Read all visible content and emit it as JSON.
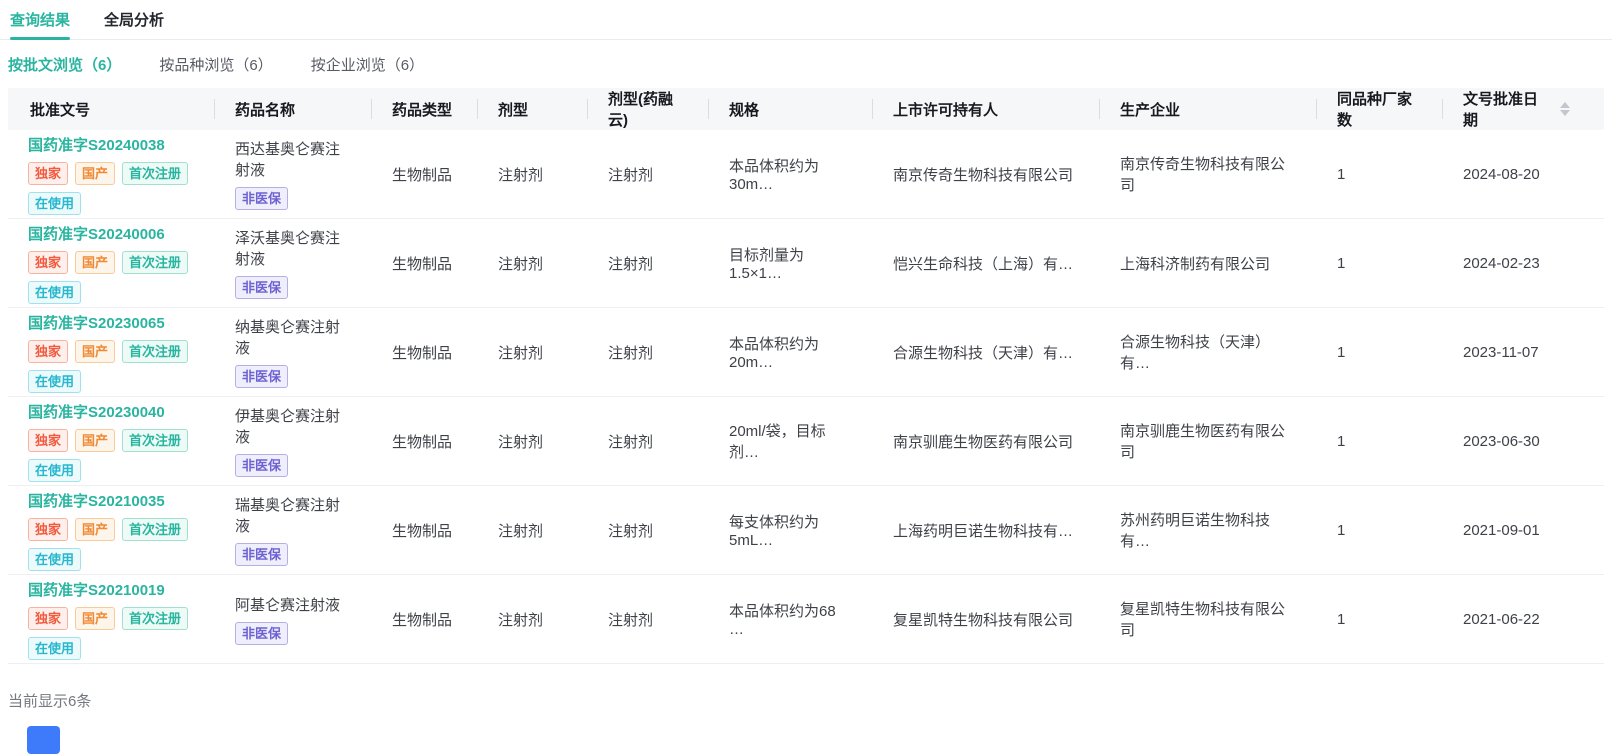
{
  "tabs": [
    {
      "label": "查询结果",
      "active": true
    },
    {
      "label": "全局分析",
      "active": false
    }
  ],
  "sub_tabs": [
    {
      "label": "按批文浏览（6）",
      "active": true
    },
    {
      "label": "按品种浏览（6）",
      "active": false
    },
    {
      "label": "按企业浏览（6）",
      "active": false
    }
  ],
  "table": {
    "columns": [
      "批准文号",
      "药品名称",
      "药品类型",
      "剂型",
      "剂型(药融云)",
      "规格",
      "上市许可持有人",
      "生产企业",
      "同品种厂家数",
      "文号批准日期"
    ],
    "rows": [
      {
        "approval_no": "国药准字S20240038",
        "approval_badges": [
          "独家",
          "国产",
          "首次注册",
          "在使用"
        ],
        "drug_name": "西达基奥仑赛注射液",
        "drug_badge": "非医保",
        "drug_type": "生物制品",
        "dosage_form": "注射剂",
        "dosage_form_yry": "注射剂",
        "spec": "本品体积约为30m…",
        "holder": "南京传奇生物科技有限公司",
        "manufacturer": "南京传奇生物科技有限公司",
        "same_species_count": "1",
        "approval_date": "2024-08-20"
      },
      {
        "approval_no": "国药准字S20240006",
        "approval_badges": [
          "独家",
          "国产",
          "首次注册",
          "在使用"
        ],
        "drug_name": "泽沃基奥仑赛注射液",
        "drug_badge": "非医保",
        "drug_type": "生物制品",
        "dosage_form": "注射剂",
        "dosage_form_yry": "注射剂",
        "spec": "目标剂量为1.5×1…",
        "holder": "恺兴生命科技（上海）有…",
        "manufacturer": "上海科济制药有限公司",
        "same_species_count": "1",
        "approval_date": "2024-02-23"
      },
      {
        "approval_no": "国药准字S20230065",
        "approval_badges": [
          "独家",
          "国产",
          "首次注册",
          "在使用"
        ],
        "drug_name": "纳基奥仑赛注射液",
        "drug_badge": "非医保",
        "drug_type": "生物制品",
        "dosage_form": "注射剂",
        "dosage_form_yry": "注射剂",
        "spec": "本品体积约为20m…",
        "holder": "合源生物科技（天津）有…",
        "manufacturer": "合源生物科技（天津）有…",
        "same_species_count": "1",
        "approval_date": "2023-11-07"
      },
      {
        "approval_no": "国药准字S20230040",
        "approval_badges": [
          "独家",
          "国产",
          "首次注册",
          "在使用"
        ],
        "drug_name": "伊基奥仑赛注射液",
        "drug_badge": "非医保",
        "drug_type": "生物制品",
        "dosage_form": "注射剂",
        "dosage_form_yry": "注射剂",
        "spec": "20ml/袋，目标剂…",
        "holder": "南京驯鹿生物医药有限公司",
        "manufacturer": "南京驯鹿生物医药有限公司",
        "same_species_count": "1",
        "approval_date": "2023-06-30"
      },
      {
        "approval_no": "国药准字S20210035",
        "approval_badges": [
          "独家",
          "国产",
          "首次注册",
          "在使用"
        ],
        "drug_name": "瑞基奥仑赛注射液",
        "drug_badge": "非医保",
        "drug_type": "生物制品",
        "dosage_form": "注射剂",
        "dosage_form_yry": "注射剂",
        "spec": "每支体积约为5mL…",
        "holder": "上海药明巨诺生物科技有…",
        "manufacturer": "苏州药明巨诺生物科技有…",
        "same_species_count": "1",
        "approval_date": "2021-09-01"
      },
      {
        "approval_no": "国药准字S20210019",
        "approval_badges": [
          "独家",
          "国产",
          "首次注册",
          "在使用"
        ],
        "drug_name": "阿基仑赛注射液",
        "drug_badge": "非医保",
        "drug_type": "生物制品",
        "dosage_form": "注射剂",
        "dosage_form_yry": "注射剂",
        "spec": "本品体积约为68 …",
        "holder": "复星凯特生物科技有限公司",
        "manufacturer": "复星凯特生物科技有限公司",
        "same_species_count": "1",
        "approval_date": "2021-06-22"
      }
    ]
  },
  "footer": {
    "summary": "当前显示6条"
  },
  "icons": {
    "sort": "caret-up-down"
  },
  "colors": {
    "accent_teal": "#2ab5a0",
    "badge_exclusive_red": "#f2593d",
    "badge_domestic_orange": "#f08a34",
    "badge_first_teal": "#2ab5a0",
    "badge_inuse_cyan": "#27b7ce",
    "badge_nonmedical_purple": "#6e62d2",
    "header_bg": "#f6f7f9",
    "pagination_blue": "#3e7bfa"
  }
}
